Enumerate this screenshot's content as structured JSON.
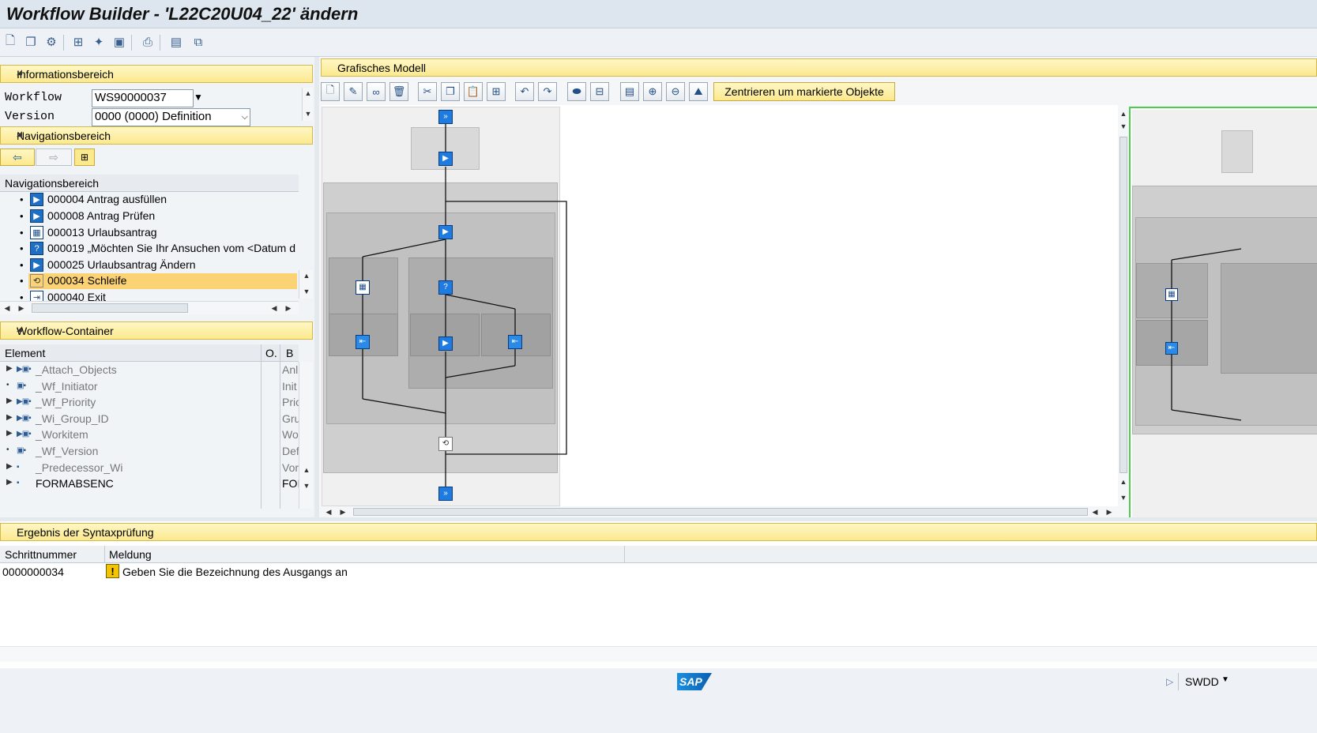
{
  "window": {
    "title": "Workflow Builder - 'L22C20U04_22' ändern"
  },
  "toolbar": {
    "icons": [
      "new-document-icon",
      "copy-icon",
      "settings-icon",
      "workflow-icon",
      "magic-wand-icon",
      "test-icon",
      "print-icon",
      "layout-icon",
      "window-icon"
    ]
  },
  "info_area": {
    "header": "Informationsbereich",
    "workflow_label": "Workflow",
    "workflow_value": "WS90000037",
    "version_label": "Version",
    "version_value": "0000 (0000) Definition"
  },
  "nav_area": {
    "header": "Navigationsbereich",
    "list_header": "Navigationsbereich",
    "items": [
      {
        "label": "000004 Antrag ausfüllen",
        "icon": "activity-icon"
      },
      {
        "label": "000008 Antrag Prüfen",
        "icon": "activity-icon"
      },
      {
        "label": "000013 Urlaubsantrag",
        "icon": "form-icon"
      },
      {
        "label": "000019 „Möchten Sie Ihr Ansuchen vom <Datum d",
        "icon": "decision-icon"
      },
      {
        "label": "000025 Urlaubsantrag Ändern",
        "icon": "activity-icon"
      },
      {
        "label": "000034 Schleife",
        "icon": "loop-icon",
        "selected": true
      },
      {
        "label": "000040 Exit",
        "icon": "exit-icon"
      }
    ]
  },
  "container": {
    "header": "Workflow-Container",
    "col_element": "Element",
    "col_o": "O.",
    "col_b": "B",
    "rows": [
      {
        "name": "_Attach_Objects",
        "value": "Anl",
        "expandable": true
      },
      {
        "name": "_Wf_Initiator",
        "value": "Init",
        "expandable": false
      },
      {
        "name": "_Wf_Priority",
        "value": "Prio",
        "expandable": true
      },
      {
        "name": "_Wi_Group_ID",
        "value": "Gru",
        "expandable": true
      },
      {
        "name": "_Workitem",
        "value": "Wo",
        "expandable": true
      },
      {
        "name": "_Wf_Version",
        "value": "Def",
        "expandable": false
      },
      {
        "name": "_Predecessor_Wi",
        "value": "Vor",
        "expandable": true
      },
      {
        "name": "FORMABSENC",
        "value": "FOI",
        "expandable": true,
        "dark": true
      }
    ]
  },
  "model": {
    "header": "Grafisches Modell",
    "center_button": "Zentrieren um markierte Objekte"
  },
  "syntax": {
    "header": "Ergebnis der Syntaxprüfung",
    "col_step": "Schrittnummer",
    "col_msg": "Meldung",
    "rows": [
      {
        "step": "0000000034",
        "message": "Geben Sie die Bezeichnung des Ausgangs an",
        "severity": "warning"
      }
    ]
  },
  "status": {
    "logo": "SAP",
    "transaction": "SWDD"
  },
  "colors": {
    "header_yellow": "#fbe98d",
    "selection": "#fbd375",
    "node_blue": "#1f7be0"
  }
}
